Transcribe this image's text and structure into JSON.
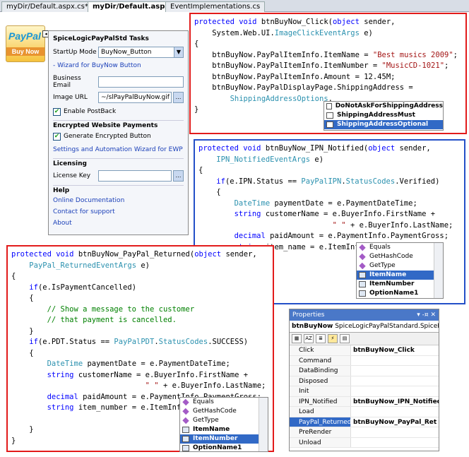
{
  "tabs": [
    "myDir/Default.aspx.cs*",
    "myDir/Default.aspx*",
    "EventImplementations.cs"
  ],
  "paypal_button": {
    "brand_pay": "Pay",
    "brand_pal": "Pal",
    "label": "Buy Now"
  },
  "tasks": {
    "title": "SpiceLogicPayPalStd Tasks",
    "startup_label": "StartUp Mode",
    "startup_value": "BuyNow_Button",
    "wizard_link": "- Wizard for BuyNow Button",
    "email_label": "Business Email",
    "email_value": "",
    "image_label": "Image URL",
    "image_value": "~/slPayPalBuyNow.gif",
    "postback_label": "Enable PostBack",
    "ewp_section": "Encrypted Website Payments",
    "gen_encrypted_label": "Generate Encrypted Button",
    "ewp_wizard_link": "Settings and Automation Wizard for EWP",
    "licensing_section": "Licensing",
    "license_label": "License Key",
    "license_value": "",
    "help_section": "Help",
    "help_links": [
      "Online Documentation",
      "Contact for support",
      "About"
    ]
  },
  "code1_isense": [
    "DoNotAskForShippingAddress",
    "ShippingAddressMust",
    "ShippingAddressOptional"
  ],
  "code2_isense": [
    "Equals",
    "GetHashCode",
    "GetType",
    "ItemName",
    "ItemNumber",
    "OptionName1"
  ],
  "code3_isense": [
    "Equals",
    "GetHashCode",
    "GetType",
    "ItemName",
    "ItemNumber",
    "OptionName1"
  ],
  "properties": {
    "title": "Properties",
    "controls": "▾ ‑¤ ✕",
    "object_name": "btnBuyNow",
    "object_type": "SpiceLogicPayPalStandard.SpiceLogi",
    "rows": [
      {
        "k": "Click",
        "v": "btnBuyNow_Click"
      },
      {
        "k": "Command",
        "v": ""
      },
      {
        "k": "DataBinding",
        "v": ""
      },
      {
        "k": "Disposed",
        "v": ""
      },
      {
        "k": "Init",
        "v": ""
      },
      {
        "k": "IPN_Notified",
        "v": "btnBuyNow_IPN_Notified"
      },
      {
        "k": "Load",
        "v": ""
      },
      {
        "k": "PayPal_Returned",
        "v": "btnBuyNow_PayPal_Ret"
      },
      {
        "k": "PreRender",
        "v": ""
      },
      {
        "k": "Unload",
        "v": ""
      }
    ]
  },
  "colors": {
    "red_border": "#e21b1b",
    "blue_border": "#2450c8",
    "keyword": "#0000ff",
    "type": "#2b91af",
    "string": "#a31515",
    "comment": "#008000"
  }
}
